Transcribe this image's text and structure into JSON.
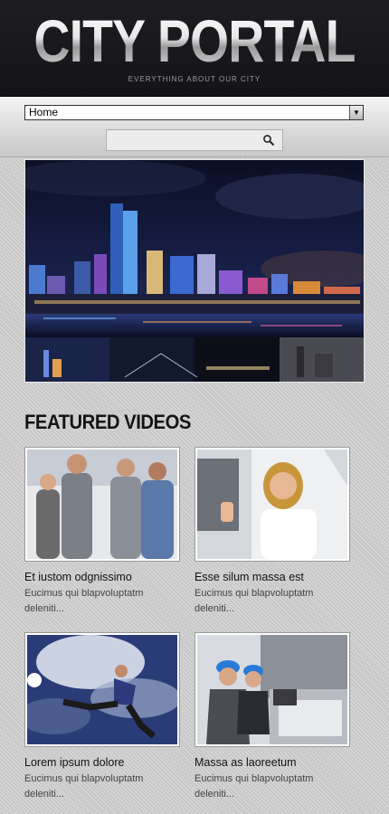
{
  "header": {
    "logo": "CITY PORTAL",
    "tagline": "EVERYTHING ABOUT OUR CITY"
  },
  "nav": {
    "selected": "Home",
    "search_value": ""
  },
  "icons": {
    "search": "magnifier",
    "dropdown": "down-arrow"
  },
  "featured": {
    "title": "FEATURED VIDEOS",
    "items": [
      {
        "title": "Et iustom odgnissimo",
        "description": "Eucimus qui blapvoluptatm deleniti..."
      },
      {
        "title": "Esse silum massa est",
        "description": "Eucimus qui blapvoluptatm deleniti..."
      },
      {
        "title": "Lorem ipsum dolore",
        "description": "Eucimus qui blapvoluptatm deleniti..."
      },
      {
        "title": "Massa as laoreetum",
        "description": "Eucimus qui blapvoluptatm deleniti..."
      }
    ]
  }
}
